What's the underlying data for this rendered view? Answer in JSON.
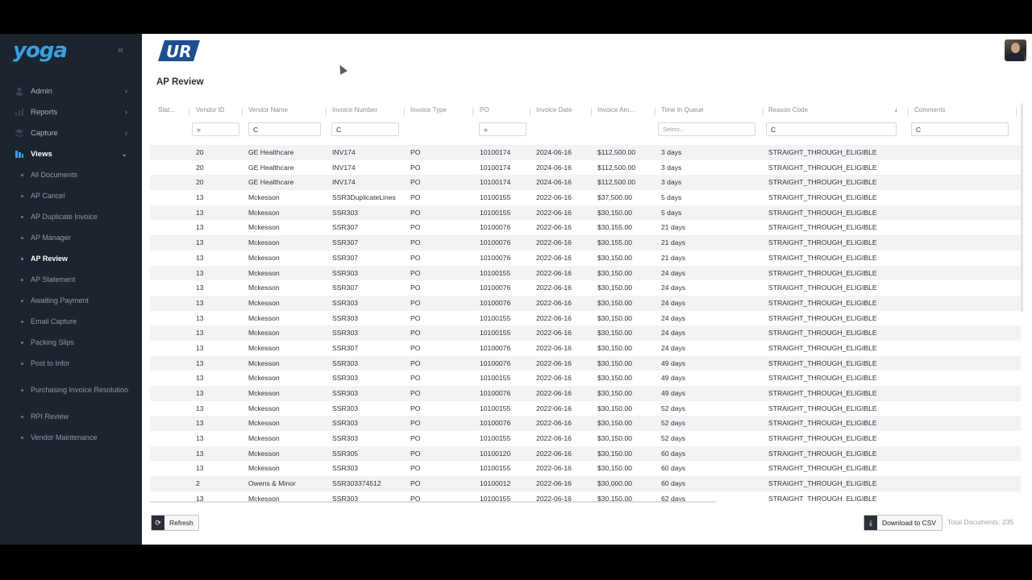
{
  "sidebar": {
    "logo": "yoga",
    "collapse": "«",
    "top_items": [
      {
        "label": "Admin",
        "chevron": "›"
      },
      {
        "label": "Reports",
        "chevron": "›"
      },
      {
        "label": "Capture",
        "chevron": "›"
      },
      {
        "label": "Views",
        "chevron": "⌄"
      }
    ],
    "view_items": [
      {
        "label": "All Documents"
      },
      {
        "label": "AP Cancel"
      },
      {
        "label": "AP Duplicate Invoice"
      },
      {
        "label": "AP Manager"
      },
      {
        "label": "AP Review"
      },
      {
        "label": "AP Statement"
      },
      {
        "label": "Awaiting Payment"
      },
      {
        "label": "Email Capture"
      },
      {
        "label": "Packing Slips"
      },
      {
        "label": "Post to Infor"
      },
      {
        "label": "Purchasing Invoice Resolution"
      },
      {
        "label": "RPI Review"
      },
      {
        "label": "Vendor Maintenance"
      }
    ],
    "active_view": "AP Review"
  },
  "header": {
    "brand_logo": "UR",
    "page_title": "AP Review"
  },
  "grid": {
    "columns": [
      {
        "label": "Stat..."
      },
      {
        "label": "Vendor ID"
      },
      {
        "label": "Vendor Name"
      },
      {
        "label": "Invoice Number"
      },
      {
        "label": "Invoice Type"
      },
      {
        "label": "PO"
      },
      {
        "label": "Invoice Date"
      },
      {
        "label": "Invoice Am..."
      },
      {
        "label": "Time In Queue"
      },
      {
        "label": "Reason Code"
      },
      {
        "label": "Comments"
      }
    ],
    "filters": {
      "vendor_id": "=",
      "vendor_name": "C",
      "invoice_number": "C",
      "po": "=",
      "time_in_queue_placeholder": "Select...",
      "reason_code": "C",
      "comments": "C"
    },
    "sort_icon": "↓",
    "rows": [
      [
        "20",
        "GE Healthcare",
        "INV174",
        "PO",
        "10100174",
        "2024-06-16",
        "$112,500.00",
        "3 days",
        "STRAIGHT_THROUGH_ELIGIBLE"
      ],
      [
        "20",
        "GE Healthcare",
        "INV174",
        "PO",
        "10100174",
        "2024-06-16",
        "$112,500.00",
        "3 days",
        "STRAIGHT_THROUGH_ELIGIBLE"
      ],
      [
        "20",
        "GE Healthcare",
        "INV174",
        "PO",
        "10100174",
        "2024-06-16",
        "$112,500.00",
        "3 days",
        "STRAIGHT_THROUGH_ELIGIBLE"
      ],
      [
        "13",
        "Mckesson",
        "SSR3DuplicateLines",
        "PO",
        "10100155",
        "2022-06-16",
        "$37,500.00",
        "5 days",
        "STRAIGHT_THROUGH_ELIGIBLE"
      ],
      [
        "13",
        "Mckesson",
        "SSR303",
        "PO",
        "10100155",
        "2022-06-16",
        "$30,150.00",
        "5 days",
        "STRAIGHT_THROUGH_ELIGIBLE"
      ],
      [
        "13",
        "Mckesson",
        "SSR307",
        "PO",
        "10100076",
        "2022-06-16",
        "$30,155.00",
        "21 days",
        "STRAIGHT_THROUGH_ELIGIBLE"
      ],
      [
        "13",
        "Mckesson",
        "SSR307",
        "PO",
        "10100076",
        "2022-06-16",
        "$30,155.00",
        "21 days",
        "STRAIGHT_THROUGH_ELIGIBLE"
      ],
      [
        "13",
        "Mckesson",
        "SSR307",
        "PO",
        "10100076",
        "2022-06-16",
        "$30,150.00",
        "21 days",
        "STRAIGHT_THROUGH_ELIGIBLE"
      ],
      [
        "13",
        "Mckesson",
        "SSR303",
        "PO",
        "10100155",
        "2022-06-16",
        "$30,150.00",
        "24 days",
        "STRAIGHT_THROUGH_ELIGIBLE"
      ],
      [
        "13",
        "Mckesson",
        "SSR307",
        "PO",
        "10100076",
        "2022-06-16",
        "$30,150.00",
        "24 days",
        "STRAIGHT_THROUGH_ELIGIBLE"
      ],
      [
        "13",
        "Mckesson",
        "SSR303",
        "PO",
        "10100076",
        "2022-06-16",
        "$30,150.00",
        "24 days",
        "STRAIGHT_THROUGH_ELIGIBLE"
      ],
      [
        "13",
        "Mckesson",
        "SSR303",
        "PO",
        "10100155",
        "2022-06-16",
        "$30,150.00",
        "24 days",
        "STRAIGHT_THROUGH_ELIGIBLE"
      ],
      [
        "13",
        "Mckesson",
        "SSR303",
        "PO",
        "10100155",
        "2022-06-16",
        "$30,150.00",
        "24 days",
        "STRAIGHT_THROUGH_ELIGIBLE"
      ],
      [
        "13",
        "Mckesson",
        "SSR307",
        "PO",
        "10100076",
        "2022-06-16",
        "$30,150.00",
        "24 days",
        "STRAIGHT_THROUGH_ELIGIBLE"
      ],
      [
        "13",
        "Mckesson",
        "SSR303",
        "PO",
        "10100076",
        "2022-06-16",
        "$30,150.00",
        "49 days",
        "STRAIGHT_THROUGH_ELIGIBLE"
      ],
      [
        "13",
        "Mckesson",
        "SSR303",
        "PO",
        "10100155",
        "2022-06-16",
        "$30,150.00",
        "49 days",
        "STRAIGHT_THROUGH_ELIGIBLE"
      ],
      [
        "13",
        "Mckesson",
        "SSR303",
        "PO",
        "10100076",
        "2022-06-16",
        "$30,150.00",
        "49 days",
        "STRAIGHT_THROUGH_ELIGIBLE"
      ],
      [
        "13",
        "Mckesson",
        "SSR303",
        "PO",
        "10100155",
        "2022-06-16",
        "$30,150.00",
        "52 days",
        "STRAIGHT_THROUGH_ELIGIBLE"
      ],
      [
        "13",
        "Mckesson",
        "SSR303",
        "PO",
        "10100076",
        "2022-06-16",
        "$30,150.00",
        "52 days",
        "STRAIGHT_THROUGH_ELIGIBLE"
      ],
      [
        "13",
        "Mckesson",
        "SSR303",
        "PO",
        "10100155",
        "2022-06-16",
        "$30,150.00",
        "52 days",
        "STRAIGHT_THROUGH_ELIGIBLE"
      ],
      [
        "13",
        "Mckesson",
        "SSR305",
        "PO",
        "10100120",
        "2022-06-16",
        "$30,150.00",
        "60 days",
        "STRAIGHT_THROUGH_ELIGIBLE"
      ],
      [
        "13",
        "Mckesson",
        "SSR303",
        "PO",
        "10100155",
        "2022-06-16",
        "$30,150.00",
        "60 days",
        "STRAIGHT_THROUGH_ELIGIBLE"
      ],
      [
        "2",
        "Owens & Minor",
        "SSR303374512",
        "PO",
        "10100012",
        "2022-06-16",
        "$30,000.00",
        "60 days",
        "STRAIGHT_THROUGH_ELIGIBLE"
      ],
      [
        "13",
        "Mckesson",
        "SSR303",
        "PO",
        "10100155",
        "2022-06-16",
        "$30,150.00",
        "62 days",
        "STRAIGHT_THROUGH_ELIGIBLE"
      ]
    ]
  },
  "footer": {
    "refresh_label": "Refresh",
    "refresh_icon": "refresh-icon",
    "download_label": "Download to CSV",
    "download_icon": "download-icon",
    "total_documents": "Total Documents: 235"
  }
}
